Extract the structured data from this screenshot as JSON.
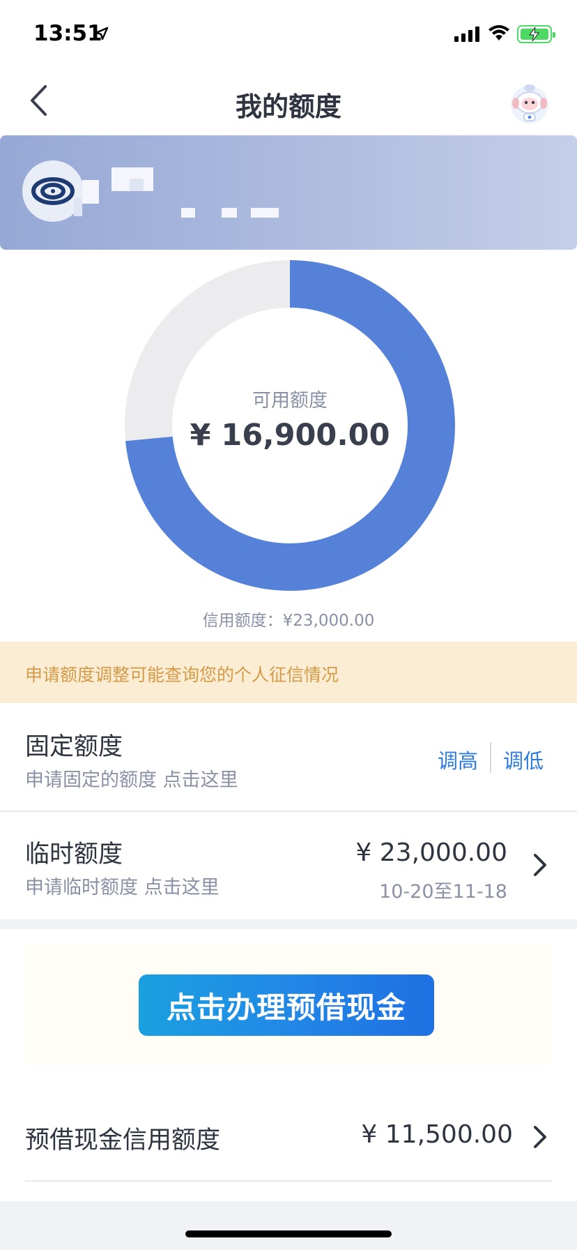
{
  "status_bar": {
    "time": "13:51"
  },
  "nav": {
    "title": "我的额度",
    "back_icon": "chevron-left-icon",
    "assistant_icon": "robot-mascot-icon"
  },
  "banner": {
    "bank_logo_icon": "bank-logo-icon"
  },
  "donut": {
    "available_label": "可用额度",
    "available_value": "¥ 16,900.00",
    "credit_line": "信用额度：¥23,000.00",
    "used_fraction": 0.2652,
    "available_color": "#5581d9",
    "used_color": "#ececee"
  },
  "notice": {
    "text": "申请额度调整可能查询您的个人征信情况"
  },
  "fixed_limit": {
    "title": "固定额度",
    "subtitle": "申请固定的额度 点击这里",
    "raise_label": "调高",
    "lower_label": "调低"
  },
  "temp_limit": {
    "title": "临时额度",
    "subtitle": "申请临时额度 点击这里",
    "amount": "¥ 23,000.00",
    "period": "10-20至11-18"
  },
  "promo": {
    "button_label": "点击办理预借现金"
  },
  "cash_advance": {
    "title": "预借现金信用额度",
    "amount": "¥ 11,500.00"
  },
  "colors": {
    "accent": "#2c7be0",
    "notice_bg": "#fbedd3",
    "notice_text": "#d49a48"
  }
}
